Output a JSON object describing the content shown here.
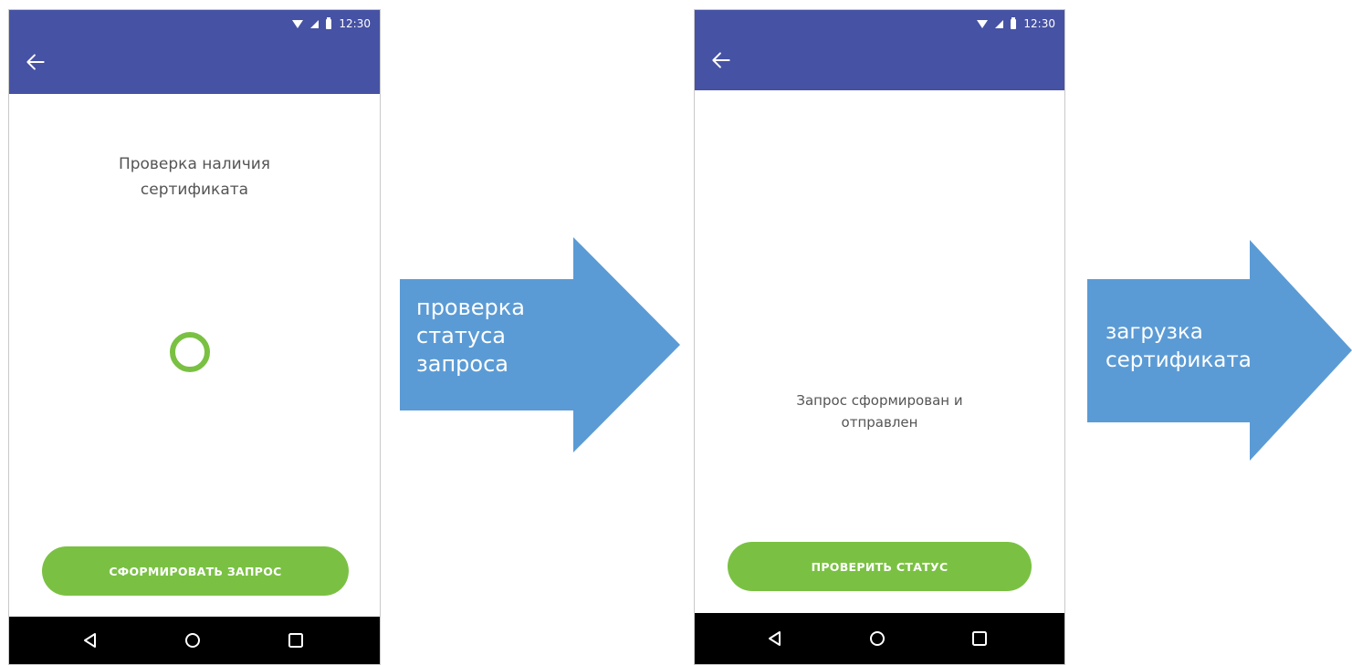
{
  "screens": [
    {
      "status_bar": {
        "time": "12:30"
      },
      "title_lines": [
        "Проверка наличия",
        "сертификата"
      ],
      "button_label": "СФОРМИРОВАТЬ ЗАПРОС"
    },
    {
      "status_bar": {
        "time": "12:30"
      },
      "message_lines": [
        "Запрос сформирован и",
        "отправлен"
      ],
      "button_label": "ПРОВЕРИТЬ СТАТУС"
    }
  ],
  "flow_arrows": [
    {
      "label_lines": [
        "проверка",
        "статуса",
        "запроса"
      ]
    },
    {
      "label_lines": [
        "загрузка",
        "сертификата"
      ]
    }
  ],
  "colors": {
    "app_bar": "#4652a4",
    "accent_green": "#7ac143",
    "arrow_blue": "#5b9bd5",
    "nav_bar": "#000000"
  },
  "icons": {
    "app_bar": "back-arrow-icon",
    "status": [
      "wifi-icon",
      "signal-icon",
      "battery-icon"
    ],
    "nav": [
      "nav-back-icon",
      "nav-home-icon",
      "nav-recents-icon"
    ],
    "loading": "loading-spinner-icon"
  }
}
